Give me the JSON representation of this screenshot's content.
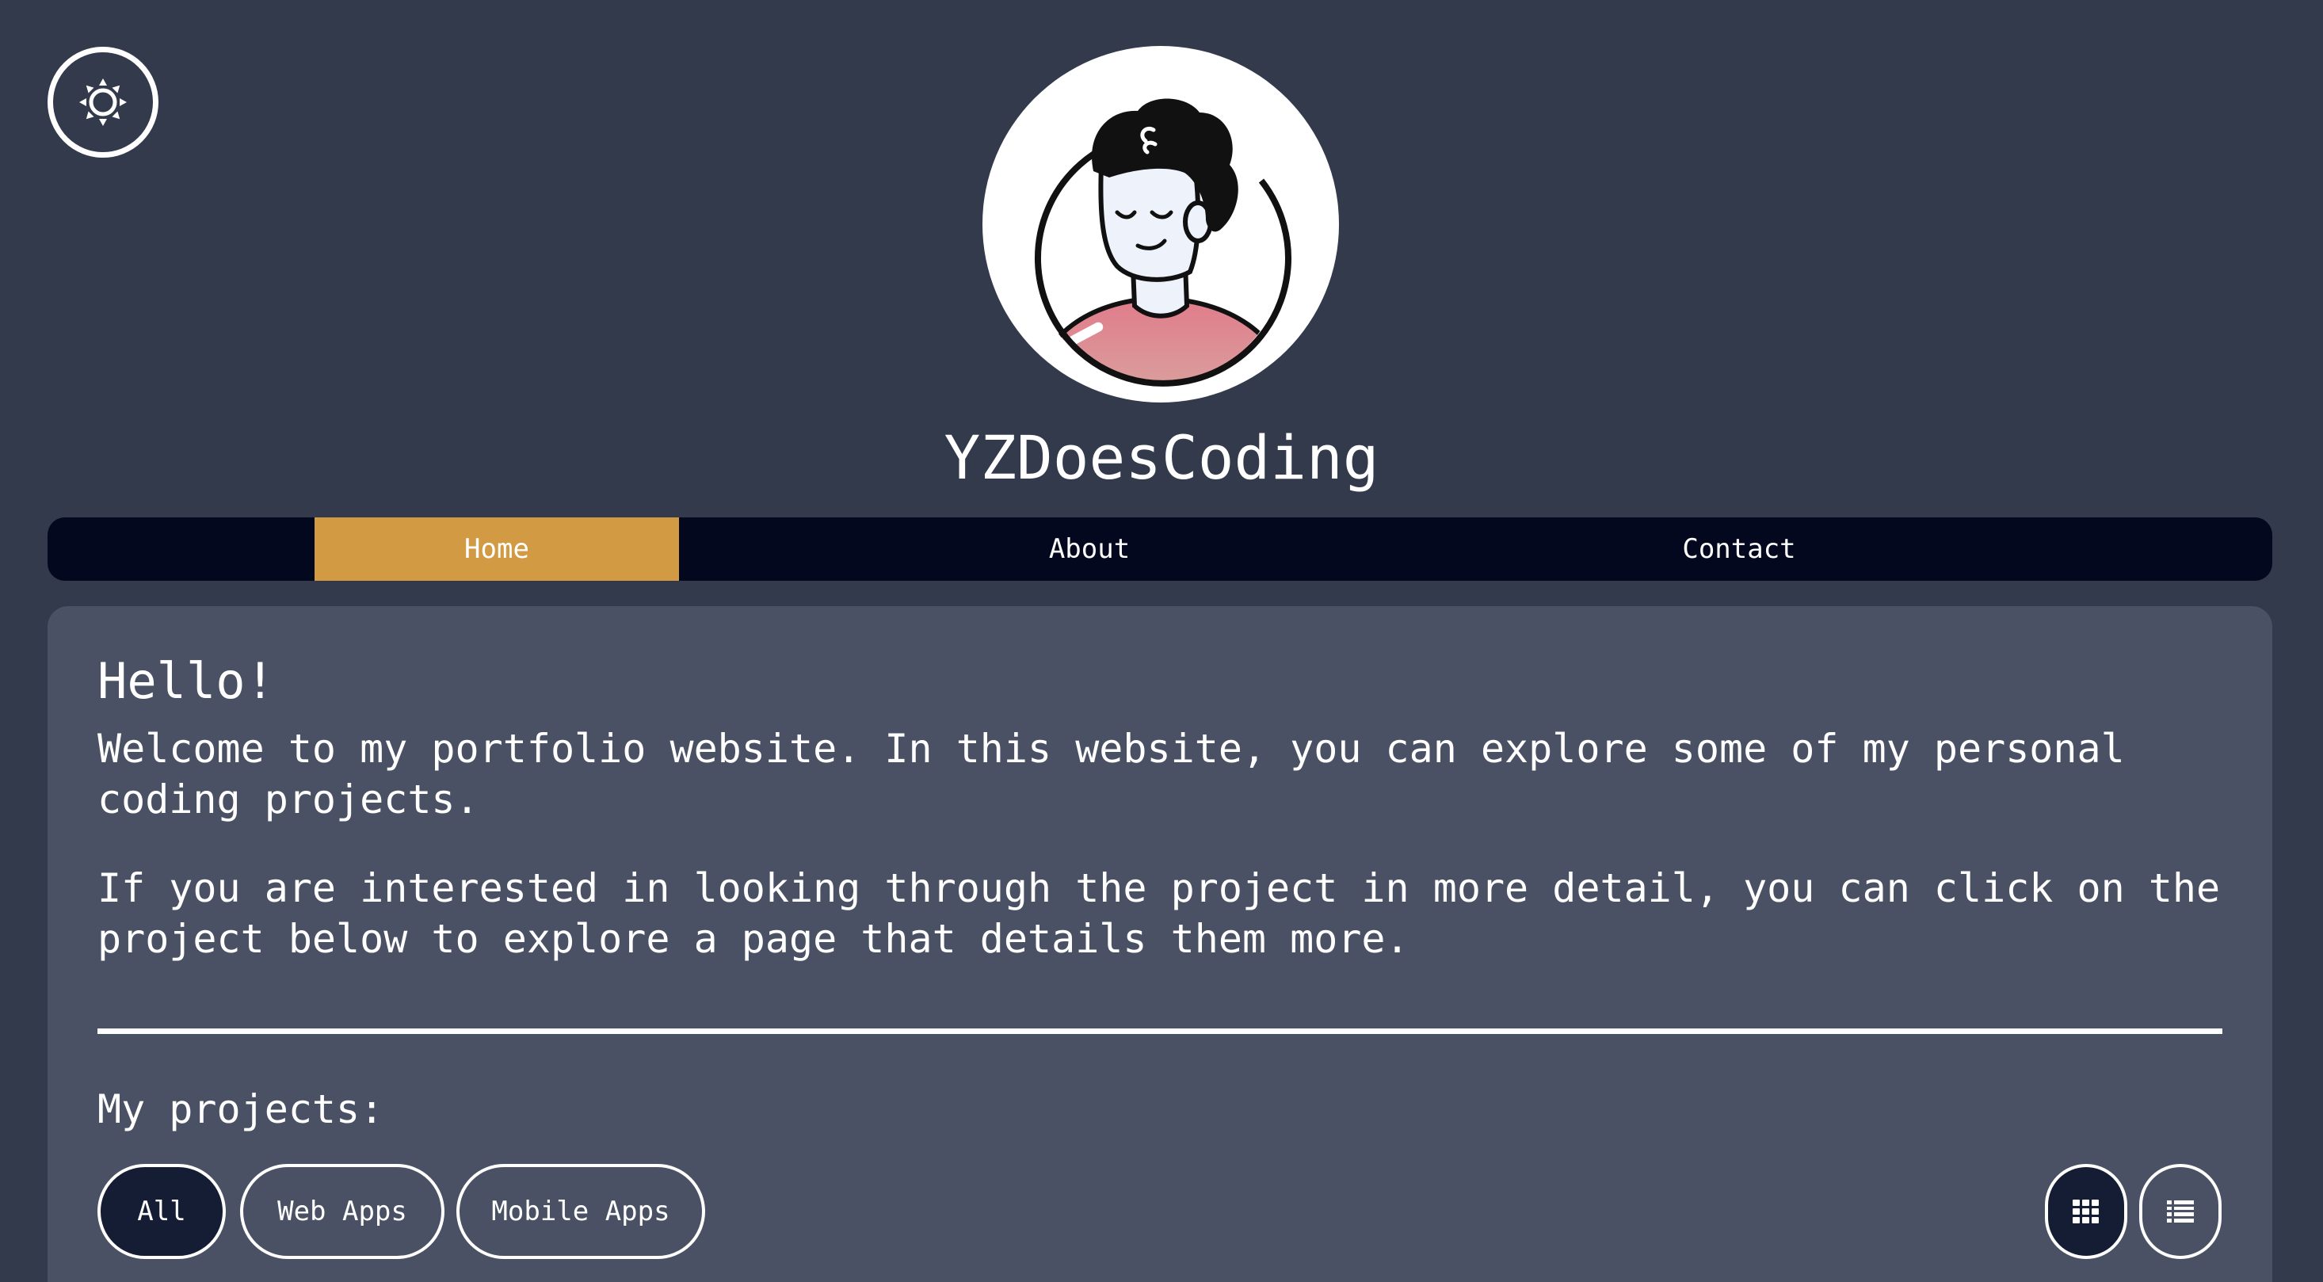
{
  "header": {
    "theme_toggle_icon": "sun-icon",
    "avatar_icon": "cartoon-avatar",
    "site_title": "YZDoesCoding"
  },
  "nav": {
    "items": [
      {
        "label": "Home",
        "active": true
      },
      {
        "label": "About",
        "active": false
      },
      {
        "label": "Contact",
        "active": false
      }
    ]
  },
  "main": {
    "greeting": "Hello!",
    "intro": "Welcome to my portfolio website. In this website, you can explore some of my personal coding projects.",
    "detail": "If you are interested in looking through the project in more detail, you can click on the project below to explore a page that details them more.",
    "projects_heading": "My projects:",
    "filters": [
      {
        "label": "All",
        "active": true
      },
      {
        "label": "Web Apps",
        "active": false
      },
      {
        "label": "Mobile Apps",
        "active": false
      }
    ],
    "view_modes": [
      {
        "icon": "grid-view-icon",
        "active": true
      },
      {
        "icon": "list-view-icon",
        "active": false
      }
    ]
  },
  "colors": {
    "page_background": "#323a4c",
    "nav_background": "#03081f",
    "nav_active": "#d29a42",
    "card_background": "#4a5164",
    "button_active": "#141d33",
    "avatar_shirt": "#e07c8a"
  }
}
